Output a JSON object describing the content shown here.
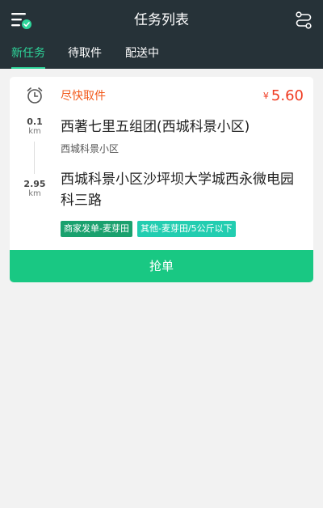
{
  "header": {
    "title": "任务列表",
    "menu_icon": "menu-check-icon",
    "route_icon": "route-icon"
  },
  "tabs": [
    {
      "label": "新任务",
      "active": true
    },
    {
      "label": "待取件",
      "active": false
    },
    {
      "label": "配送中",
      "active": false
    }
  ],
  "task": {
    "urgency": "尽快取件",
    "currency": "¥",
    "price": "5.60",
    "pickup": {
      "distance": "0.1",
      "unit": "km",
      "title": "西著七里五组团(西城科景小区)",
      "subtitle": "西城科景小区"
    },
    "dropoff": {
      "distance": "2.95",
      "unit": "km",
      "title": "西城科景小区沙坪坝大学城西永微电园科三路"
    },
    "tags": [
      "商家发单-麦芽田",
      "其他-麦芽田/5公斤以下"
    ],
    "grab_label": "抢单"
  },
  "colors": {
    "header_bg": "#263238",
    "accent_green": "#2ed59a",
    "button_green": "#19c883",
    "urgency_orange": "#f25a1c",
    "price_red": "#f03b21"
  }
}
